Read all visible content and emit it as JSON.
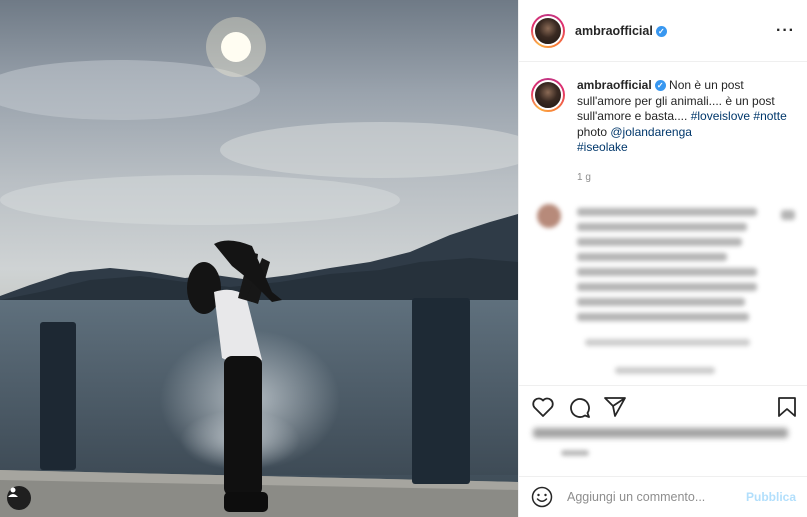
{
  "post": {
    "username": "ambraofficial",
    "verified_icon": "verified-badge-icon",
    "more_icon": "more-options-icon"
  },
  "caption": {
    "username": "ambraofficial",
    "text_1": "Non è un post sull'amore per gli animali.... è un post sull'amore e basta.... ",
    "tag_1": "#loveislove",
    "tag_2": "#notte",
    "text_2": " photo ",
    "mention": "@jolandarenga",
    "tag_3": "#iseolake",
    "time": "1 g"
  },
  "actions": {
    "like_icon": "heart-icon",
    "comment_icon": "comment-icon",
    "share_icon": "share-icon",
    "save_icon": "bookmark-icon"
  },
  "add_comment": {
    "placeholder": "Aggiungi un commento...",
    "publish_label": "Pubblica",
    "emoji_icon": "emoji-icon"
  },
  "colors": {
    "accent": "#3897f0",
    "hashtag": "#00376b",
    "publish_disabled": "#b2dffc"
  }
}
